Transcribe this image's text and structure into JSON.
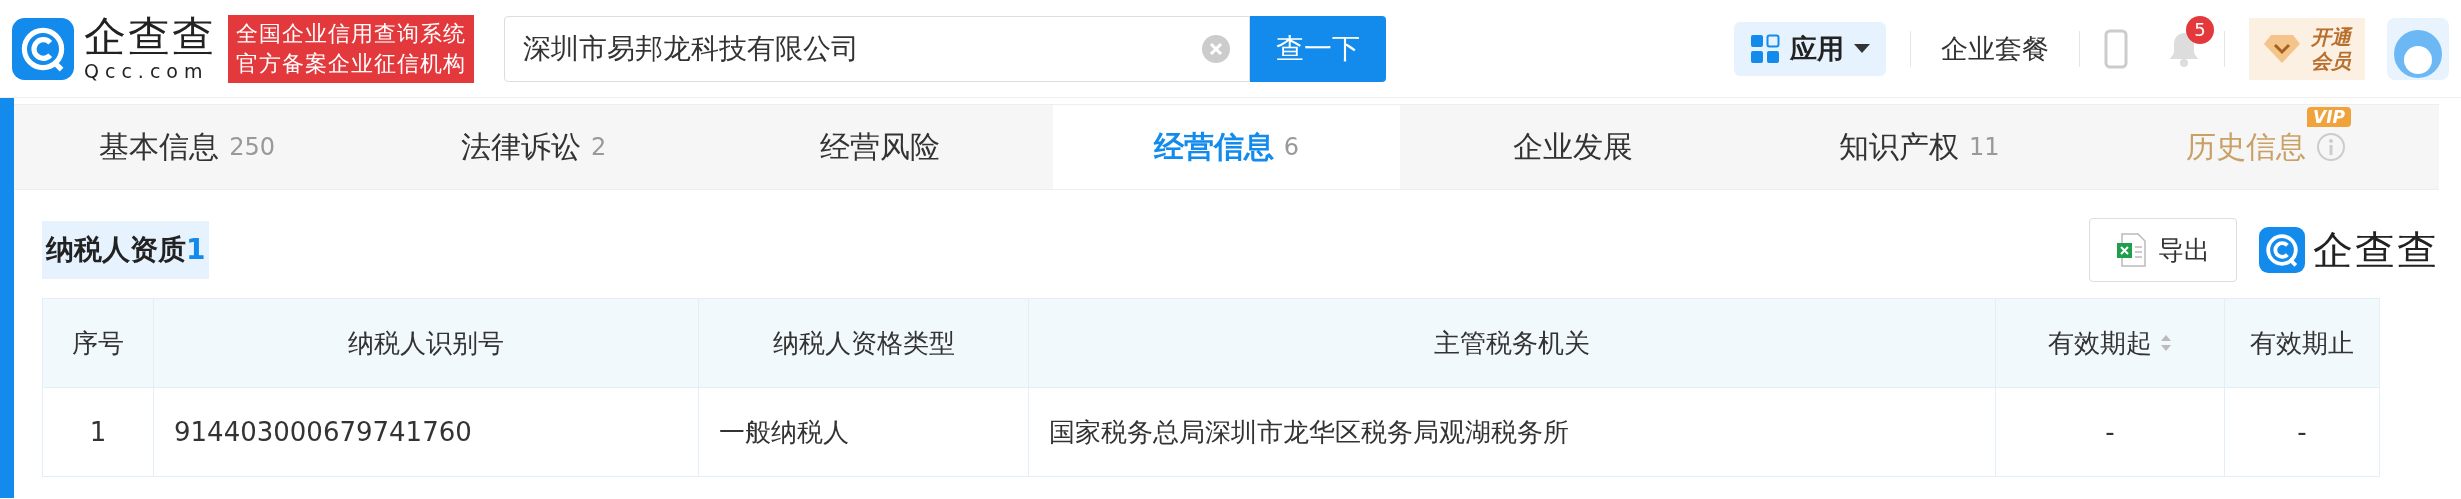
{
  "header": {
    "logo": {
      "name": "企查查",
      "domain": "Qcc.com"
    },
    "slogan": [
      "全国企业信用查询系统",
      "官方备案企业征信机构"
    ],
    "search": {
      "value": "深圳市易邦龙科技有限公司",
      "button": "查一下"
    },
    "apps_button": "应用",
    "package_link": "企业套餐",
    "notification_count": "5",
    "vip_button": [
      "开通",
      "会员"
    ]
  },
  "tabs": [
    {
      "label": "基本信息",
      "count": "250",
      "selected": false,
      "kind": "normal"
    },
    {
      "label": "法律诉讼",
      "count": "2",
      "selected": false,
      "kind": "normal"
    },
    {
      "label": "经营风险",
      "selected": false,
      "kind": "normal"
    },
    {
      "label": "经营信息",
      "count": "6",
      "selected": true,
      "kind": "normal"
    },
    {
      "label": "企业发展",
      "selected": false,
      "kind": "normal"
    },
    {
      "label": "知识产权",
      "count": "11",
      "selected": false,
      "kind": "normal"
    },
    {
      "label": "历史信息",
      "badge": "VIP",
      "selected": false,
      "kind": "vip"
    }
  ],
  "section": {
    "title": "纳税人资质",
    "count": "1",
    "export_button": "导出",
    "brand": "企查查"
  },
  "table": {
    "columns": [
      {
        "label": "序号",
        "sortable": false
      },
      {
        "label": "纳税人识别号",
        "sortable": false
      },
      {
        "label": "纳税人资格类型",
        "sortable": false
      },
      {
        "label": "主管税务机关",
        "sortable": false
      },
      {
        "label": "有效期起",
        "sortable": true
      },
      {
        "label": "有效期止",
        "sortable": false
      }
    ],
    "rows": [
      [
        "1",
        "914403000679741760",
        "一般纳税人",
        "国家税务总局深圳市龙华区税务局观湖税务所",
        "-",
        "-"
      ]
    ]
  }
}
